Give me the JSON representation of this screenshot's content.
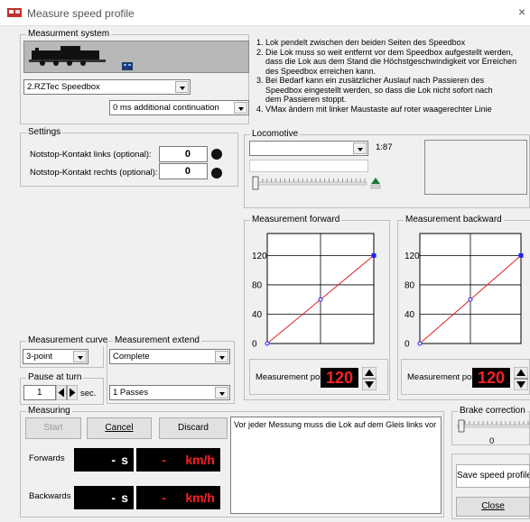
{
  "window": {
    "title": "Measure speed profile",
    "close_glyph": "×"
  },
  "measurement_system": {
    "label": "Measurment system",
    "device_select": "2.RZTec Speedbox",
    "continuation_select": "0 ms additional continuation",
    "instructions": [
      "1. Lok pendelt zwischen den beiden Seiten des Speedbox",
      "2. Die Lok muss so weit entfernt vor dem Speedbox aufgestellt werden,",
      "    dass die Lok aus dem Stand die Höchstgeschwindigkeit vor Erreichen",
      "    des Speedbox erreichen kann.",
      "3. Bei Bedarf kann ein zusätzlicher Auslauf nach Passieren des",
      "    Speedbox eingestellt werden, so dass die Lok nicht sofort nach",
      "    dem Passieren stoppt.",
      "4. VMax ändern mit linker Maustaste auf roter waagerechter Linie"
    ]
  },
  "settings": {
    "label": "Settings",
    "notstop_left_label": "Notstop-Kontakt links (optional):",
    "notstop_left_value": "0",
    "notstop_right_label": "Notstop-Kontakt rechts (optional):",
    "notstop_right_value": "0"
  },
  "locomotive": {
    "label": "Locomotive",
    "select": "",
    "scale": "1:87"
  },
  "measurement_forward": {
    "label": "Measurement forward",
    "points_label": "Measurement poi",
    "points_value": "120"
  },
  "measurement_backward": {
    "label": "Measurement backward",
    "points_label": "Measurement poi",
    "points_value": "120"
  },
  "chart_data": [
    {
      "type": "line",
      "title": "Measurement forward",
      "x": [
        0,
        1,
        2
      ],
      "y": [
        0,
        60,
        120
      ],
      "yticks": [
        0,
        40,
        80,
        120
      ],
      "ylim": [
        0,
        150
      ],
      "series_color": "#e02020",
      "point_color": "#2020ff"
    },
    {
      "type": "line",
      "title": "Measurement backward",
      "x": [
        0,
        1,
        2
      ],
      "y": [
        0,
        60,
        120
      ],
      "yticks": [
        0,
        40,
        80,
        120
      ],
      "ylim": [
        0,
        150
      ],
      "series_color": "#e02020",
      "point_color": "#2020ff"
    }
  ],
  "measurement_curve": {
    "label": "Measurement curve",
    "select": "3-point"
  },
  "measurement_extend": {
    "label": "Measurement extend",
    "select": "Complete",
    "passes_select": "1 Passes"
  },
  "pause_at_turn": {
    "label": "Pause at turn",
    "value": "1",
    "unit": "sec."
  },
  "measuring": {
    "label": "Measuring",
    "start": "Start",
    "cancel": "Cancel",
    "discard": "Discard",
    "forwards_label": "Forwards",
    "backwards_label": "Backwards",
    "time_value": "-",
    "time_unit": "s",
    "speed_value": "-",
    "speed_unit": "km/h",
    "message": "Vor jeder Messung muss die Lok auf dem Gleis links vor"
  },
  "brake_correction": {
    "label": "Brake correction",
    "value": "0"
  },
  "actions": {
    "save": "Save speed profile",
    "close": "Close"
  }
}
